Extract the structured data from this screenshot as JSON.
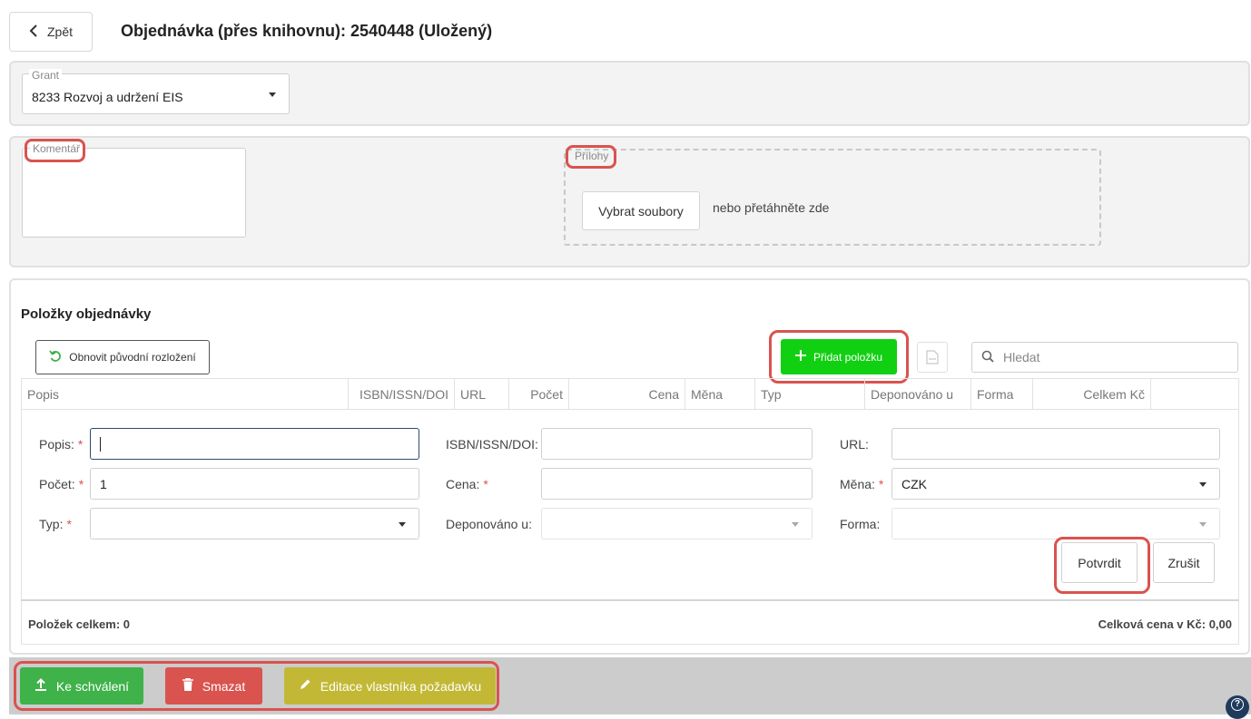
{
  "header": {
    "back_label": "Zpět",
    "title": "Objednávka (přes knihovnu): 2540448 (Uložený)"
  },
  "grant": {
    "label": "Grant",
    "value": "8233 Rozvoj a udržení EIS"
  },
  "comment": {
    "label": "Komentář",
    "value": ""
  },
  "attachments": {
    "label": "Přílohy",
    "choose_button": "Vybrat soubory",
    "drop_hint": "nebo přetáhněte zde"
  },
  "items_section": {
    "title": "Položky objednávky",
    "reset_layout_button": "Obnovit původní rozložení",
    "add_item_button": "Přidat položku",
    "search_placeholder": "Hledat",
    "columns": [
      "Popis",
      "ISBN/ISSN/DOI",
      "URL",
      "Počet",
      "Cena",
      "Měna",
      "Typ",
      "Deponováno u",
      "Forma",
      "Celkem Kč"
    ]
  },
  "item_form": {
    "popis_label": "Popis:",
    "popis_value": "",
    "isbn_label": "ISBN/ISSN/DOI:",
    "isbn_value": "",
    "url_label": "URL:",
    "url_value": "",
    "pocet_label": "Počet:",
    "pocet_value": "1",
    "cena_label": "Cena:",
    "cena_value": "",
    "mena_label": "Měna:",
    "mena_value": "CZK",
    "typ_label": "Typ:",
    "typ_value": "",
    "deponovano_label": "Deponováno u:",
    "deponovano_value": "",
    "forma_label": "Forma:",
    "forma_value": "",
    "required_mark": "*",
    "confirm_button": "Potvrdit",
    "cancel_button": "Zrušit"
  },
  "summary": {
    "count_label": "Položek celkem: 0",
    "total_label": "Celková cena v Kč: 0,00"
  },
  "footer": {
    "approve_button": "Ke schválení",
    "delete_button": "Smazat",
    "edit_owner_button": "Editace vlastníka požadavku",
    "help_icon_glyph": "?"
  },
  "colors": {
    "add_green": "#11d011",
    "approve_green": "#3fb24a",
    "delete_red": "#d9534f",
    "edit_olive": "#c2b835",
    "highlight_red": "#d9534f",
    "footer_bg": "#cccccc"
  }
}
